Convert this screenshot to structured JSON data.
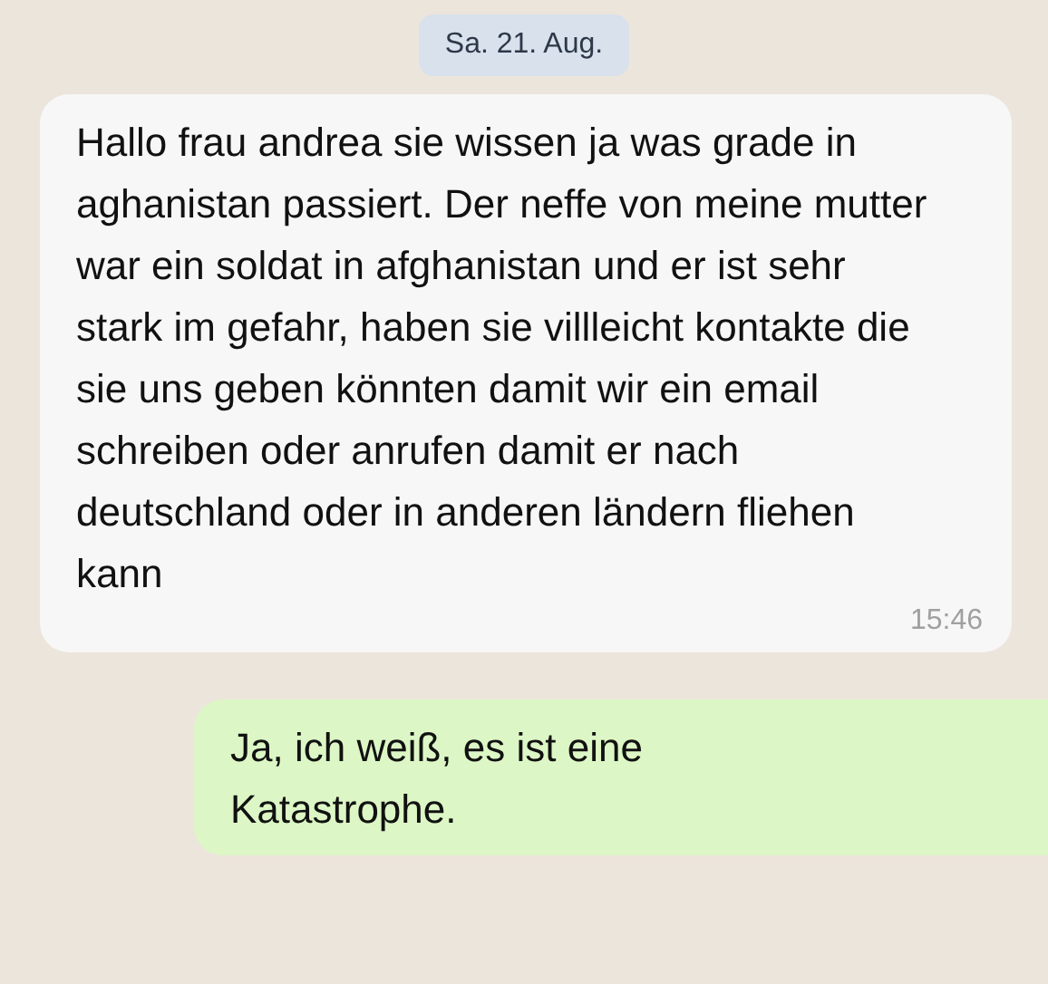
{
  "date_label": "Sa. 21. Aug.",
  "messages": [
    {
      "kind": "incoming",
      "text": "Hallo frau andrea sie wissen ja was grade in aghanistan passiert. Der neffe von meine mutter war ein soldat in afghanistan und er ist sehr stark im gefahr, haben sie villleicht kontakte die sie uns geben könnten damit wir ein email schreiben oder anrufen damit er nach deutschland oder in anderen ländern fliehen kann",
      "time": "15:46"
    },
    {
      "kind": "outgoing",
      "text": "Ja, ich weiß, es ist eine Katastrophe."
    }
  ]
}
